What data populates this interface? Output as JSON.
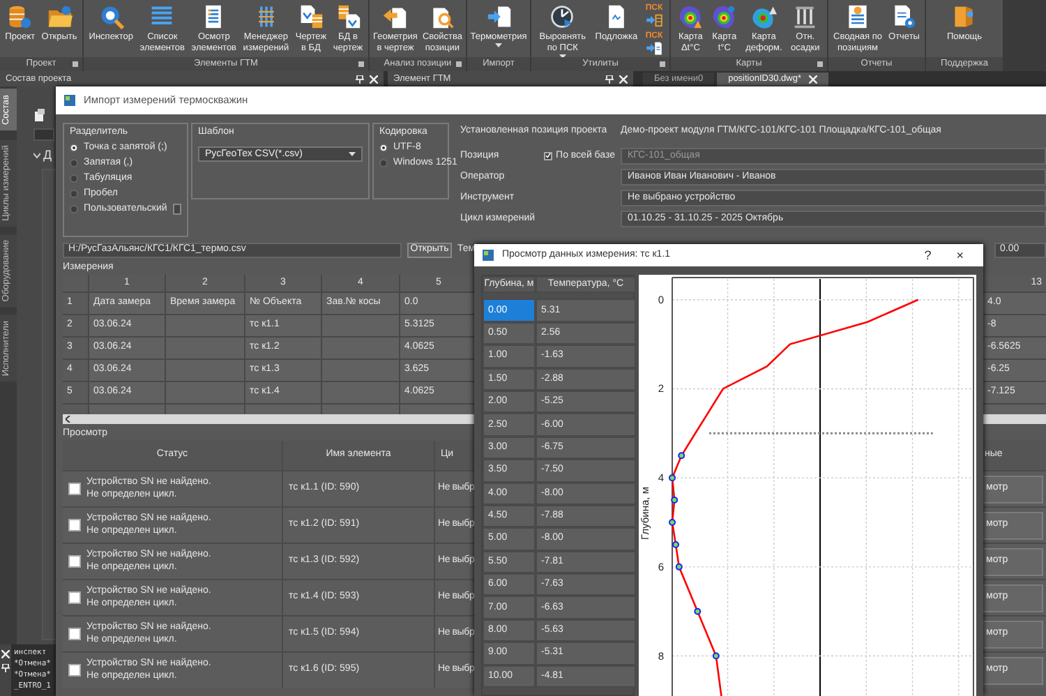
{
  "ribbon": {
    "groups": [
      {
        "label": "Проект",
        "launcher": true,
        "buttons": [
          {
            "kind": "large",
            "lines": [
              "Проект"
            ]
          },
          {
            "kind": "large",
            "lines": [
              "Открыть"
            ]
          }
        ]
      },
      {
        "label": "Элементы ГТМ",
        "launcher": true,
        "buttons": [
          {
            "kind": "large",
            "lines": [
              "Инспектор"
            ]
          },
          {
            "kind": "large",
            "lines": [
              "Список",
              "элементов"
            ]
          },
          {
            "kind": "large",
            "lines": [
              "Осмотр",
              "элементов"
            ]
          },
          {
            "kind": "large",
            "lines": [
              "Менеджер",
              "измерений"
            ]
          },
          {
            "kind": "large",
            "lines": [
              "Чертеж",
              "в БД"
            ]
          },
          {
            "kind": "large",
            "lines": [
              "БД в",
              "чертеж"
            ]
          }
        ]
      },
      {
        "label": "Анализ позиции",
        "launcher": true,
        "buttons": [
          {
            "kind": "large",
            "lines": [
              "Геометрия",
              "в чертеж"
            ]
          },
          {
            "kind": "large",
            "lines": [
              "Свойства",
              "позиции"
            ]
          }
        ]
      },
      {
        "label": "Импорт",
        "launcher": false,
        "buttons": [
          {
            "kind": "large",
            "lines": [
              "Термометрия"
            ],
            "caret": true
          }
        ]
      },
      {
        "label": "Утилиты",
        "launcher": true,
        "buttons": [
          {
            "kind": "large",
            "lines": [
              "Выровнять",
              "по ПСК"
            ],
            "caret": true
          },
          {
            "kind": "large",
            "lines": [
              "Подложка"
            ]
          },
          {
            "kind": "stack",
            "items": [
              {
                "text": "ПСК"
              },
              {
                "text": "ПСК"
              }
            ]
          }
        ]
      },
      {
        "label": "Карты",
        "launcher": true,
        "buttons": [
          {
            "kind": "large",
            "lines": [
              "Карта",
              "Δt°C"
            ]
          },
          {
            "kind": "large",
            "lines": [
              "Карта",
              "t°C"
            ]
          },
          {
            "kind": "large",
            "lines": [
              "Карта",
              "деформ."
            ]
          },
          {
            "kind": "large",
            "lines": [
              "Отн.",
              "осадки"
            ]
          }
        ]
      },
      {
        "label": "Отчеты",
        "launcher": false,
        "buttons": [
          {
            "kind": "large",
            "lines": [
              "Сводная по",
              "позициям"
            ]
          },
          {
            "kind": "large",
            "lines": [
              "Отчеты"
            ]
          }
        ]
      },
      {
        "label": "Поддержка",
        "launcher": false,
        "buttons": [
          {
            "kind": "large",
            "lines": [
              "Помощь"
            ]
          }
        ]
      }
    ]
  },
  "panels": [
    {
      "title": "Состав проекта"
    },
    {
      "title": "Элемент ГТМ"
    }
  ],
  "doc_tabs": [
    {
      "label": "Без имени0",
      "selected": false
    },
    {
      "label": "positionID30.dwg*",
      "selected": true
    }
  ],
  "side_tabs": [
    {
      "label": "Состав",
      "selected": true
    },
    {
      "label": "Циклы измерений",
      "selected": false
    },
    {
      "label": "Оборудование",
      "selected": false
    },
    {
      "label": "Исполнители",
      "selected": false
    }
  ],
  "tree": [
    {
      "label": "Д",
      "expanded": true
    }
  ],
  "command_lines": [
    "инспект",
    "*Отмена*",
    "*Отмена*",
    "_ENTRO_1"
  ],
  "import_dialog": {
    "title": "Импорт измерений термоскважин",
    "separator": {
      "label": "Разделитель",
      "options": [
        {
          "label": "Точка с запятой (;)",
          "selected": true
        },
        {
          "label": "Запятая (,)",
          "selected": false
        },
        {
          "label": "Табуляция",
          "selected": false
        },
        {
          "label": "Пробел",
          "selected": false
        },
        {
          "label": "Пользовательский",
          "selected": false
        }
      ]
    },
    "template": {
      "label": "Шаблон",
      "value": "РусГеоТех CSV(*.csv)"
    },
    "encoding": {
      "label": "Кодировка",
      "options": [
        {
          "label": "UTF-8",
          "selected": true
        },
        {
          "label": "Windows 1251",
          "selected": false
        }
      ]
    },
    "fields": [
      {
        "kind": "text",
        "label": "Установленная позиция проекта",
        "value": "Демо-проект модуля ГТМ/КГС-101/КГС-101 Площадка/КГС-101_общая"
      },
      {
        "kind": "field",
        "label": "Позиция",
        "checkbox": {
          "label": "По всей базе",
          "checked": true
        },
        "value": "КГС-101_общая",
        "disabled": true
      },
      {
        "kind": "field",
        "label": "Оператор",
        "value": "Иванов Иван Иванович - Иванов",
        "disabled": false
      },
      {
        "kind": "field",
        "label": "Инструмент",
        "value": "Не выбрано устройство",
        "disabled": false
      },
      {
        "kind": "field",
        "label": "Цикл измерений",
        "value": "01.10.25 - 31.10.25 - 2025 Октябрь",
        "disabled": false
      }
    ],
    "file": {
      "path": "H:/РусГазАльянс/КГС1/КГС1_термо.csv",
      "button": "Открыть",
      "next_label": "Тем",
      "next_value": "0.00"
    },
    "measurements": {
      "label": "Измерения",
      "columns": [
        "1",
        "2",
        "3",
        "4",
        "5"
      ],
      "last_column": "13",
      "rows": [
        {
          "header": "1",
          "cells": [
            "Дата замера",
            "Время замера",
            "№ Объекта",
            "Зав.№ косы",
            "0.0"
          ],
          "last": "4.0"
        },
        {
          "header": "2",
          "cells": [
            "03.06.24",
            null,
            "тс к1.1",
            null,
            "5.3125"
          ],
          "last": "-8"
        },
        {
          "header": "3",
          "cells": [
            "03.06.24",
            null,
            "тс к1.2",
            null,
            "4.0625"
          ],
          "last": "-6.5625"
        },
        {
          "header": "4",
          "cells": [
            "03.06.24",
            null,
            "тс к1.3",
            null,
            "3.625"
          ],
          "last": "-6.25"
        },
        {
          "header": "5",
          "cells": [
            "03.06.24",
            null,
            "тс к1.4",
            null,
            "4.0625"
          ],
          "last": "-7.125"
        }
      ]
    },
    "preview": {
      "label": "Просмотр",
      "columns": [
        "Статус",
        "Имя элемента",
        "Ци"
      ],
      "last_column": "ные",
      "rows": [
        {
          "checked": false,
          "status": [
            "Устройство SN  не найдено.",
            "Не определен цикл."
          ],
          "name": "тс к1.1 (ID: 590)",
          "cycle": "Не выбр",
          "action": "мотр"
        },
        {
          "checked": false,
          "status": [
            "Устройство SN  не найдено.",
            "Не определен цикл."
          ],
          "name": "тс к1.2 (ID: 591)",
          "cycle": "Не выбр",
          "action": "мотр"
        },
        {
          "checked": false,
          "status": [
            "Устройство SN  не найдено.",
            "Не определен цикл."
          ],
          "name": "тс к1.3 (ID: 592)",
          "cycle": "Не выбр",
          "action": "мотр"
        },
        {
          "checked": false,
          "status": [
            "Устройство SN  не найдено.",
            "Не определен цикл."
          ],
          "name": "тс к1.4 (ID: 593)",
          "cycle": "Не выбр",
          "action": "мотр"
        },
        {
          "checked": false,
          "status": [
            "Устройство SN  не найдено.",
            "Не определен цикл."
          ],
          "name": "тс к1.5 (ID: 594)",
          "cycle": "Не выбр",
          "action": "мотр"
        },
        {
          "checked": false,
          "status": [
            "Устройство SN  не найдено.",
            "Не определен цикл."
          ],
          "name": "тс к1.6 (ID: 595)",
          "cycle": "Не выбр",
          "action": "мотр"
        }
      ]
    }
  },
  "preview_dialog": {
    "title": "Просмотр данных измерения: тс к1.1",
    "help": "?",
    "close": "×",
    "columns": [
      "Глубина, м",
      "Температура, °С"
    ],
    "rows": [
      {
        "depth": "0.00",
        "temp": "5.31",
        "selected": true,
        "marked": false
      },
      {
        "depth": "0.50",
        "temp": "2.56",
        "selected": false,
        "marked": false
      },
      {
        "depth": "1.00",
        "temp": "-1.63",
        "selected": false,
        "marked": false
      },
      {
        "depth": "1.50",
        "temp": "-2.88",
        "selected": false,
        "marked": false
      },
      {
        "depth": "2.00",
        "temp": "-5.25",
        "selected": false,
        "marked": false
      },
      {
        "depth": "2.50",
        "temp": "-6.00",
        "selected": false,
        "marked": false
      },
      {
        "depth": "3.00",
        "temp": "-6.75",
        "selected": false,
        "marked": false,
        "threshold": true
      },
      {
        "depth": "3.50",
        "temp": "-7.50",
        "selected": false,
        "marked": true
      },
      {
        "depth": "4.00",
        "temp": "-8.00",
        "selected": false,
        "marked": true
      },
      {
        "depth": "4.50",
        "temp": "-7.88",
        "selected": false,
        "marked": true
      },
      {
        "depth": "5.00",
        "temp": "-8.00",
        "selected": false,
        "marked": true
      },
      {
        "depth": "5.50",
        "temp": "-7.81",
        "selected": false,
        "marked": true
      },
      {
        "depth": "6.00",
        "temp": "-7.63",
        "selected": false,
        "marked": true
      },
      {
        "depth": "7.00",
        "temp": "-6.63",
        "selected": false,
        "marked": true
      },
      {
        "depth": "8.00",
        "temp": "-5.63",
        "selected": false,
        "marked": true
      },
      {
        "depth": "9.00",
        "temp": "-5.31",
        "selected": false,
        "marked": false
      },
      {
        "depth": "10.00",
        "temp": "-4.81",
        "selected": false,
        "marked": false
      }
    ],
    "chart": {
      "ylabel": "Глубина, м",
      "yticks": [
        "0",
        "2",
        "4",
        "6",
        "8"
      ]
    }
  }
}
